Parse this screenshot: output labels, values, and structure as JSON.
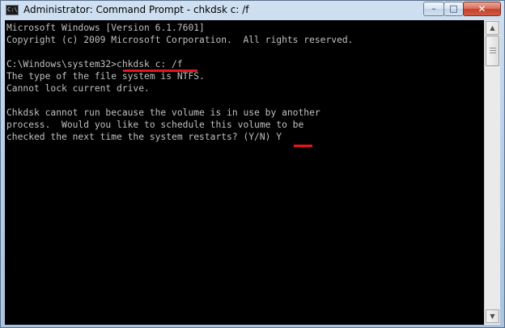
{
  "window": {
    "title": "Administrator: Command Prompt - chkdsk  c: /f",
    "icon_text": "C:\\"
  },
  "controls": {
    "minimize_icon": "minimize-icon",
    "maximize_icon": "maximize-icon",
    "close_icon": "close-icon",
    "minimize_glyph": "–",
    "maximize_glyph": "□",
    "close_glyph": "✕"
  },
  "console": {
    "lines": [
      "Microsoft Windows [Version 6.1.7601]",
      "Copyright (c) 2009 Microsoft Corporation.  All rights reserved.",
      "",
      "C:\\Windows\\system32>chkdsk c: /f",
      "The type of the file system is NTFS.",
      "Cannot lock current drive.",
      "",
      "Chkdsk cannot run because the volume is in use by another",
      "process.  Would you like to schedule this volume to be",
      "checked the next time the system restarts? (Y/N) Y"
    ],
    "text_color": "#c0c0c0",
    "background": "#000000",
    "highlight_color": "#e8141b"
  },
  "scrollbar": {
    "up_glyph": "▲",
    "down_glyph": "▼"
  }
}
